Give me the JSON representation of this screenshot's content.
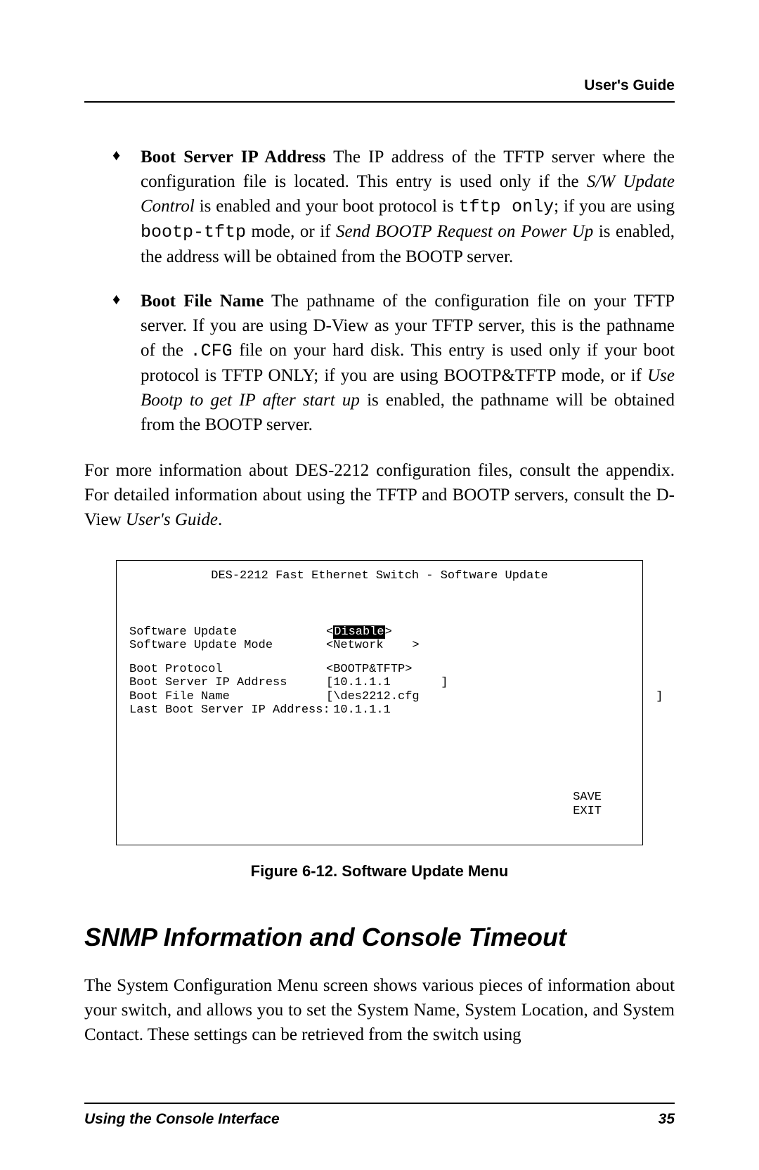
{
  "header": {
    "title": "User's Guide"
  },
  "bullet1": {
    "label": "Boot Server IP Address",
    "t1": "  The IP address of the TFTP server where the configuration file is located. This entry is used only if the ",
    "i1": "S/W Update Control",
    "t2": " is enabled and your boot protocol is ",
    "m1": "tftp only",
    "t3": "; if you are using ",
    "m2": "bootp-tftp",
    "t4": " mode, or if ",
    "i2": "Send BOOTP Request on Power Up ",
    "t5": " is enabled, the address will be obtained from the BOOTP server."
  },
  "bullet2": {
    "label": "Boot File Name",
    "t1": "   The pathname of the configuration file on your TFTP server.  If you are using D-View as your TFTP server, this is the pathname of the ",
    "m1": ".CFG",
    "t2": " file on your hard disk.  This entry is used only if your boot protocol is TFTP ONLY; if you are using BOOTP&TFTP mode, or if ",
    "i1": "Use Bootp to get IP after start up",
    "t3": " is enabled, the pathname will be obtained from the BOOTP server."
  },
  "para": {
    "t1": "For more information about DES-2212 configuration files, consult the appendix.   For detailed information about using the TFTP and BOOTP servers, consult the D-View ",
    "i1": "User's Guide",
    "t2": "."
  },
  "terminal": {
    "title": "DES-2212 Fast Ethernet Switch - Software Update",
    "rows": {
      "r1": {
        "label": "Software Update",
        "pre": "<",
        "highlight": "Disable",
        "post": ">"
      },
      "r2": {
        "label": "Software Update Mode",
        "val": "<Network    >"
      },
      "r3": {
        "label": "Boot Protocol",
        "val": "<BOOTP&TFTP>"
      },
      "r4": {
        "label": "Boot Server IP Address",
        "val": "[10.1.1.1       ]"
      },
      "r5": {
        "label": "Boot File Name",
        "val": "[\\des2212.cfg                                 ]"
      },
      "r6": {
        "label": "Last Boot Server IP Address:",
        "val": " 10.1.1.1"
      }
    },
    "buttons": {
      "save": "SAVE",
      "exit": "EXIT"
    }
  },
  "figure_caption": "Figure 6-12. Software Update Menu",
  "section_heading": "SNMP Information and Console Timeout",
  "section_para": "The System Configuration Menu screen shows various pieces of information about your switch, and allows you to set the System Name, System Location, and System Contact.  These settings can be retrieved from the switch using",
  "footer": {
    "left": "Using the Console Interface",
    "page": "35"
  }
}
